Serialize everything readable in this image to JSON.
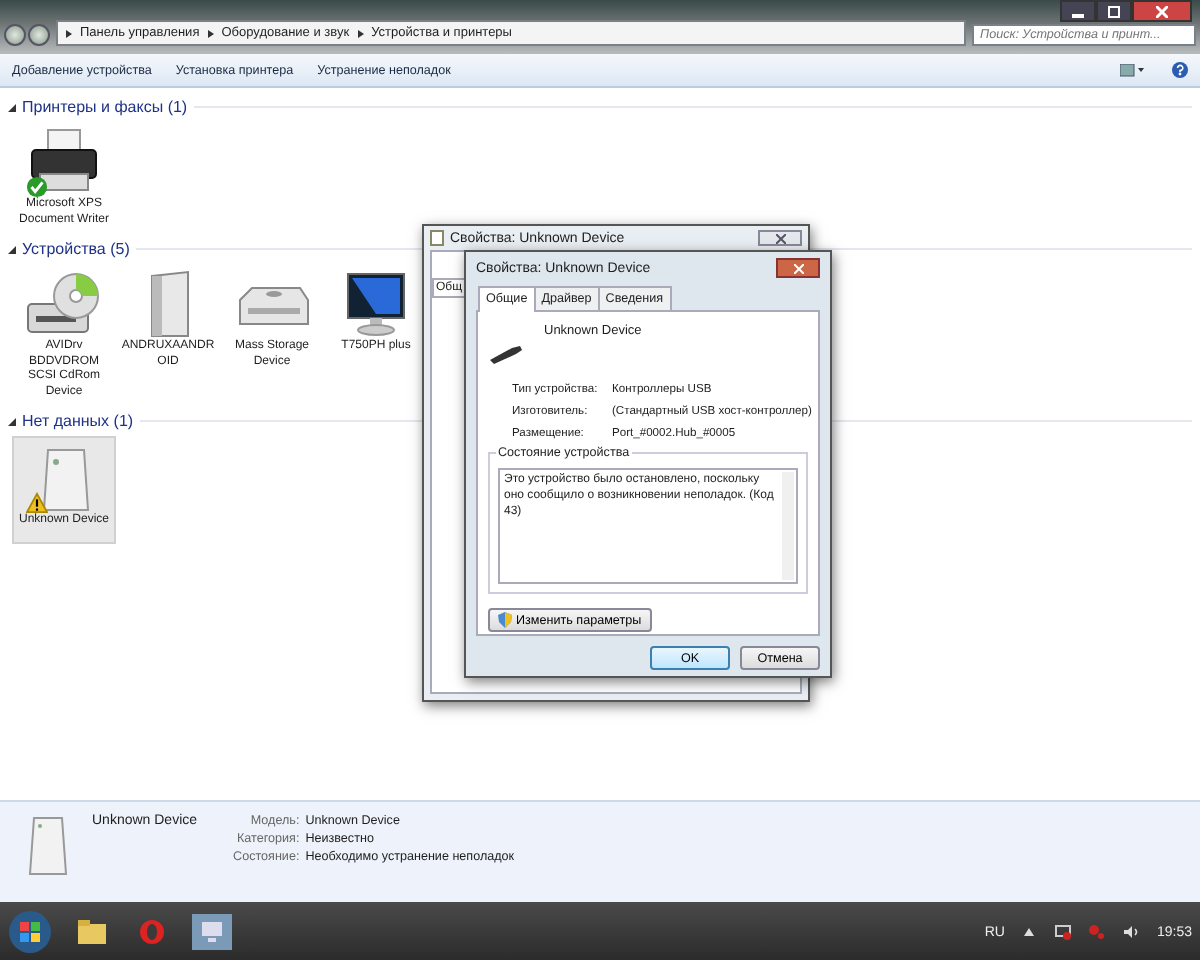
{
  "window": {
    "breadcrumb": [
      "Панель управления",
      "Оборудование и звук",
      "Устройства и принтеры"
    ],
    "search": {
      "placeholder": "Поиск: Устройства и принт..."
    }
  },
  "toolbar": [
    "Добавление устройства",
    "Установка принтера",
    "Устранение неполадок"
  ],
  "groups": [
    {
      "title": "Принтеры и факсы (1)",
      "items": [
        {
          "name": "Microsoft XPS Document Writer",
          "kind": "printer",
          "default": true,
          "problem": false,
          "selected": false
        }
      ]
    },
    {
      "title": "Устройства (5)",
      "items": [
        {
          "name": "AVIDrv BDDVDROM SCSI CdRom Device",
          "kind": "cdrom",
          "default": false,
          "problem": false,
          "selected": false
        },
        {
          "name": "ANDRUXAANDR OID",
          "kind": "drive",
          "default": false,
          "problem": false,
          "selected": false
        },
        {
          "name": "Mass Storage Device",
          "kind": "disk",
          "default": false,
          "problem": false,
          "selected": false
        },
        {
          "name": "T750PH plus",
          "kind": "monitor",
          "default": false,
          "problem": false,
          "selected": false
        }
      ]
    },
    {
      "title": "Нет данных (1)",
      "items": [
        {
          "name": "Unknown Device",
          "kind": "tower",
          "default": false,
          "problem": true,
          "selected": true
        }
      ]
    }
  ],
  "back_dialog": {
    "title": "Свойства: Unknown Device",
    "tab": "Общ"
  },
  "dialog": {
    "title": "Свойства: Unknown Device",
    "tabs": [
      {
        "label": "Общие",
        "selected": true
      },
      {
        "label": "Драйвер",
        "selected": false
      },
      {
        "label": "Сведения",
        "selected": false
      }
    ],
    "device_name": "Unknown Device",
    "properties": [
      {
        "label": "Тип устройства:",
        "value": "Контроллеры USB"
      },
      {
        "label": "Изготовитель:",
        "value": "(Стандартный USB хост-контроллер)"
      },
      {
        "label": "Размещение:",
        "value": "Port_#0002.Hub_#0005"
      }
    ],
    "status_group": "Состояние устройства",
    "status_text": "Это устройство было остановлено, поскольку оно сообщило о возникновении неполадок. (Код 43)",
    "change_button": "Изменить параметры",
    "buttons": [
      "OK",
      "Отмена"
    ]
  },
  "details": {
    "name": "Unknown Device",
    "fields": [
      {
        "label": "Модель:",
        "value": "Unknown Device"
      },
      {
        "label": "Категория:",
        "value": "Неизвестно"
      },
      {
        "label": "Состояние:",
        "value": "Необходимо устранение неполадок"
      }
    ]
  },
  "taskbar": {
    "language": "RU",
    "time": "19:53"
  }
}
